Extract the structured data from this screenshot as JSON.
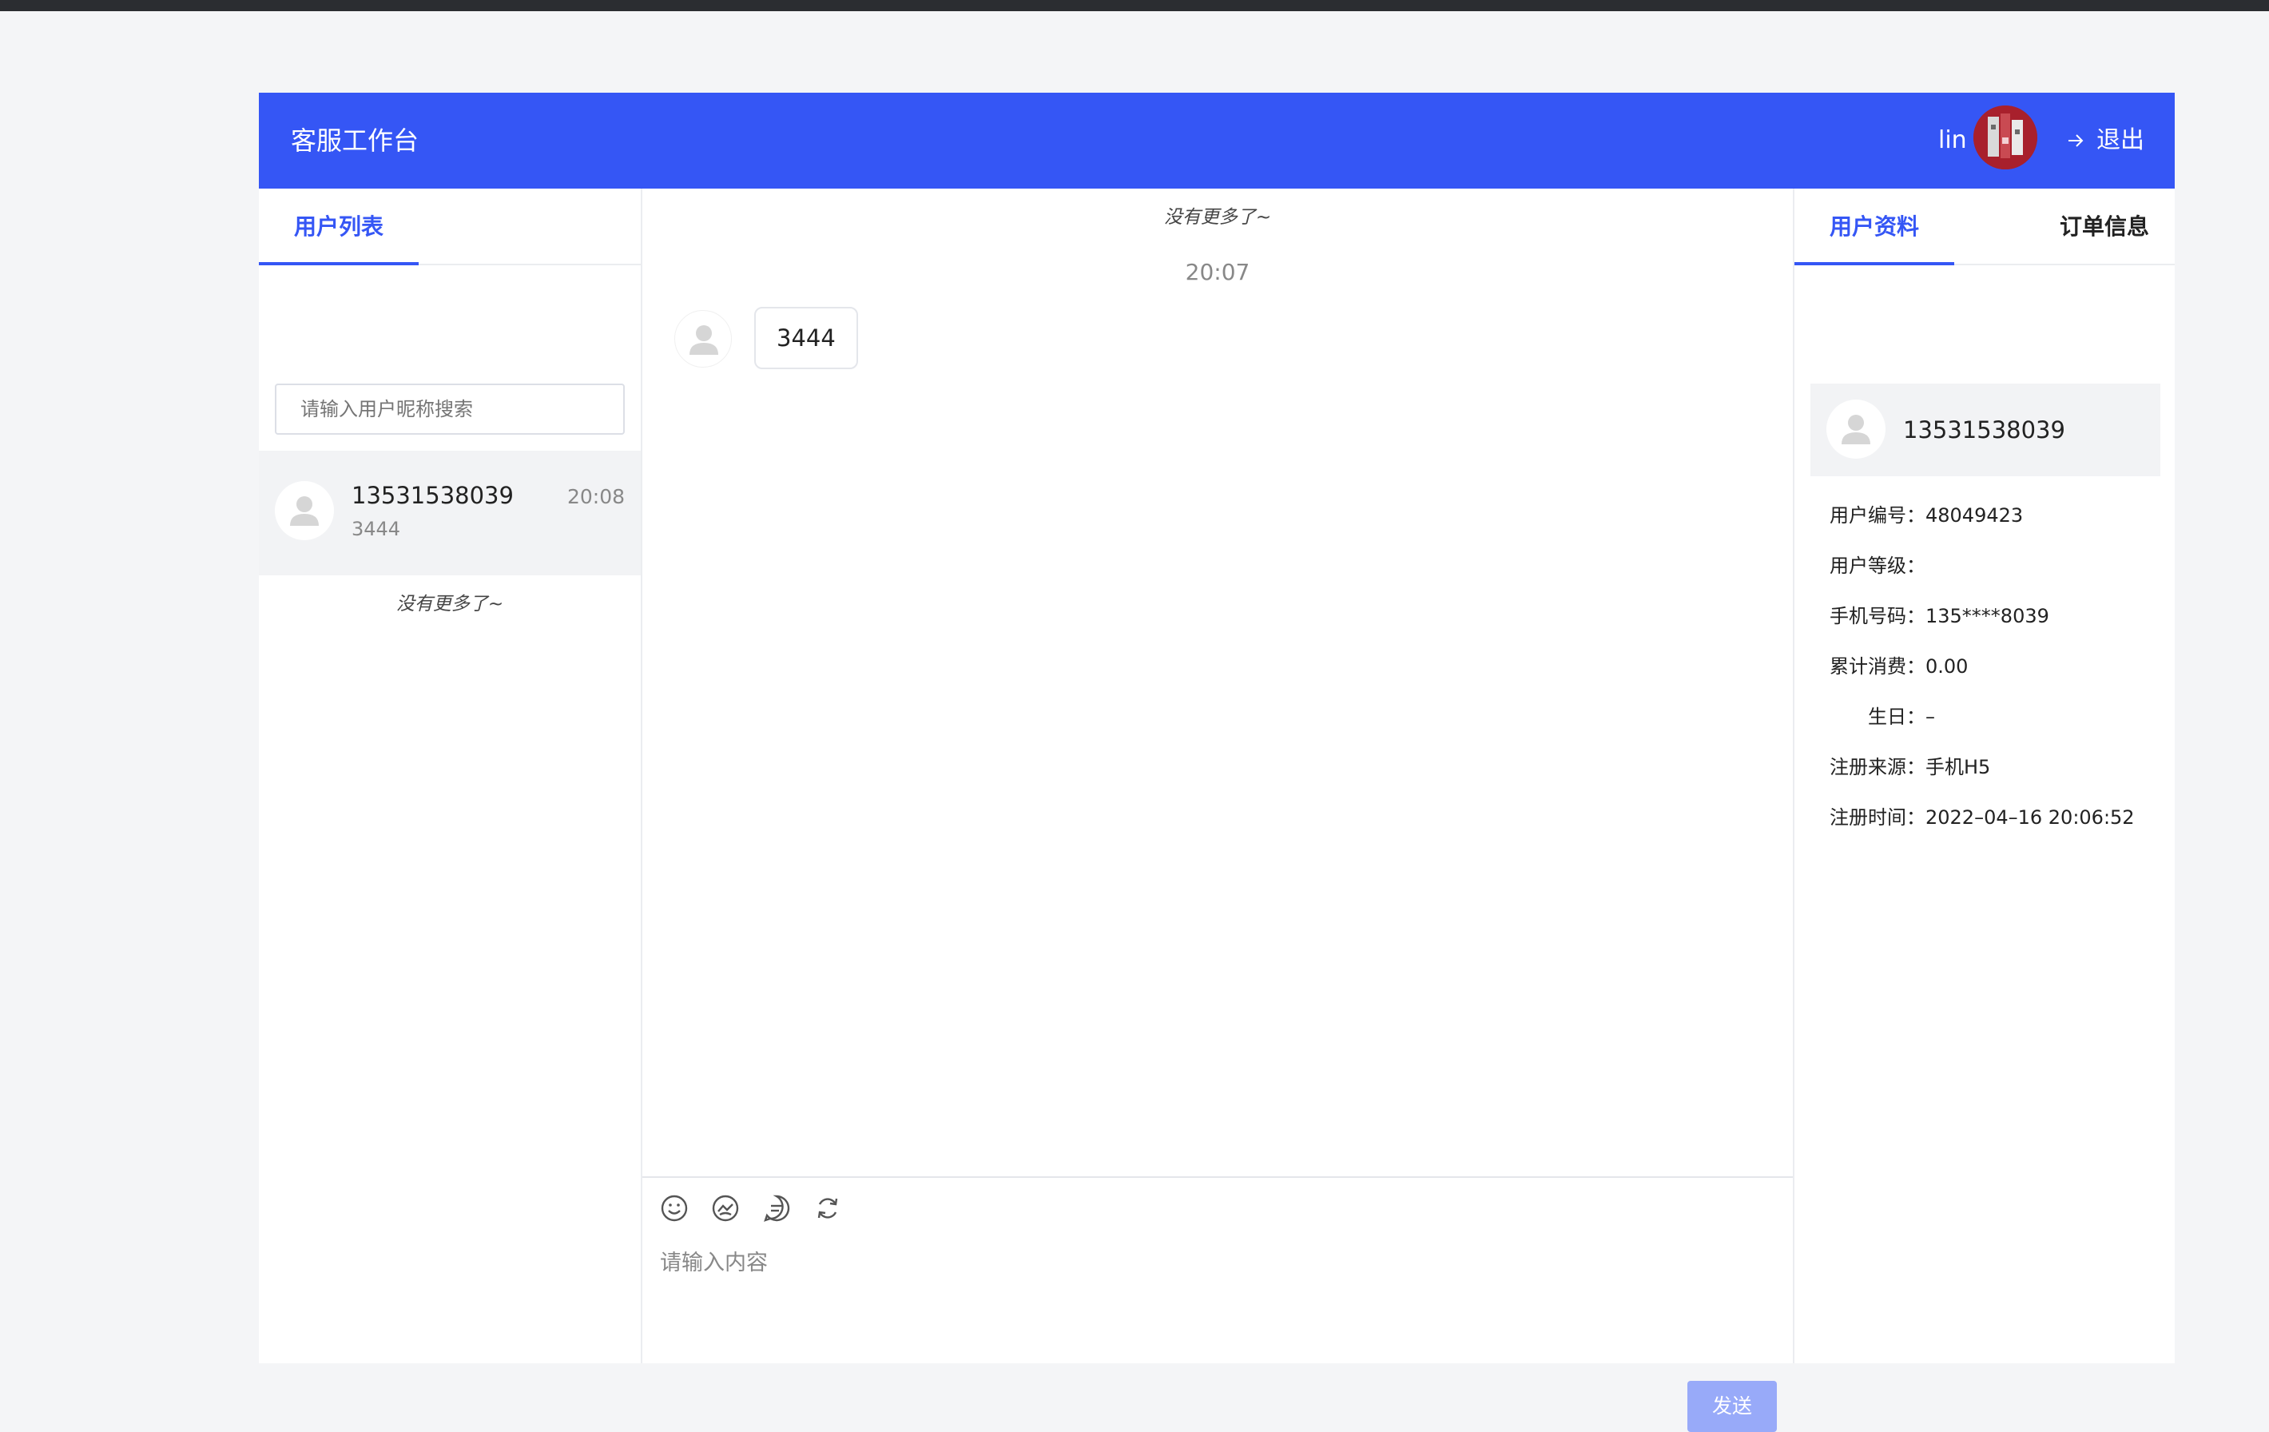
{
  "header": {
    "title": "客服工作台",
    "username": "lin",
    "logout": "退出",
    "color": "#3556f5"
  },
  "left": {
    "tab": "用户列表",
    "search_placeholder": "请输入用户昵称搜索",
    "users": [
      {
        "name": "13531538039",
        "time": "20:08",
        "last_message": "3444"
      }
    ],
    "no_more": "没有更多了~"
  },
  "chat": {
    "no_more": "没有更多了~",
    "timestamp": "20:07",
    "messages": [
      {
        "text": "3444"
      }
    ],
    "tools": [
      "smile-icon",
      "sticker-icon",
      "quick-reply-icon",
      "refresh-icon"
    ],
    "input_placeholder": "请输入内容",
    "send": "发送"
  },
  "right": {
    "tabs": [
      "用户资料",
      "订单信息"
    ],
    "profile_name": "13531538039",
    "fields": [
      {
        "label": "用户编号：",
        "value": "48049423"
      },
      {
        "label": "用户等级：",
        "value": ""
      },
      {
        "label": "手机号码：",
        "value": "135****8039"
      },
      {
        "label": "累计消费：",
        "value": "0.00"
      },
      {
        "label": "生日：",
        "value": "–"
      },
      {
        "label": "注册来源：",
        "value": "手机H5"
      },
      {
        "label": "注册时间：",
        "value": "2022–04–16 20:06:52"
      }
    ]
  }
}
